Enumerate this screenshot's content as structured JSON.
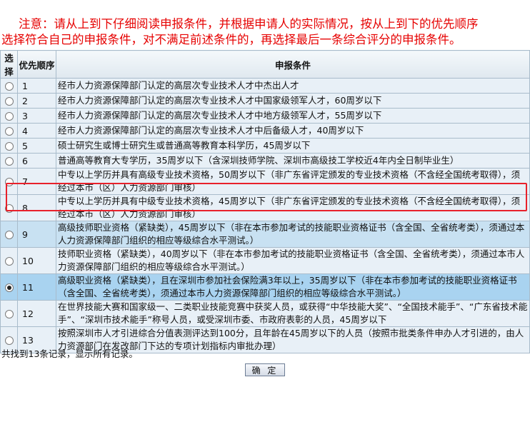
{
  "notice": {
    "line1": "注意：请从上到下仔细阅读申报条件，并根据申请人的实际情况，按从上到下的优先顺序",
    "line2": "选择符合自己的申报条件，对不满足前述条件的，再选择最后一条综合评分的申报条件。"
  },
  "table": {
    "headers": [
      "选择",
      "优先顺序",
      "申报条件"
    ],
    "rows": [
      {
        "num": "1",
        "text": "经市人力资源保障部门认定的高层次专业技术人才中杰出人才"
      },
      {
        "num": "2",
        "text": "经市人力资源保障部门认定的高层次专业技术人才中国家级领军人才，60周岁以下"
      },
      {
        "num": "3",
        "text": "经市人力资源保障部门认定的高层次专业技术人才中地方级领军人才，55周岁以下"
      },
      {
        "num": "4",
        "text": "经市人力资源保障部门认定的高层次专业技术人才中后备级人才，40周岁以下"
      },
      {
        "num": "5",
        "text": "硕士研究生或博士研究生或普通高等教育本科学历，45周岁以下"
      },
      {
        "num": "6",
        "text": "普通高等教育大专学历，35周岁以下（含深圳技师学院、深圳市高级技工学校近4年内全日制毕业生）"
      },
      {
        "num": "7",
        "text": "中专以上学历并具有高级专业技术资格，50周岁以下（非广东省评定颁发的专业技术资格（不含经全国统考取得），须经过本市（区）人力资源部门审核）"
      },
      {
        "num": "8",
        "text": "中专以上学历并具有中级专业技术资格，45周岁以下（非广东省评定颁发的专业技术资格（不含经全国统考取得），须经过本市（区）人力资源部门审核）"
      },
      {
        "num": "9",
        "text": "高级技师职业资格（紧缺类），45周岁以下（非在本市参加考试的技能职业资格证书（含全国、全省统考类），须通过本人力资源保障部门组织的相应等级综合水平测试。）"
      },
      {
        "num": "10",
        "text": "技师职业资格（紧缺类），40周岁以下（非在本市参加考试的技能职业资格证书（含全国、全省统考类），须通过本市人力资源保障部门组织的相应等级综合水平测试。）"
      },
      {
        "num": "11",
        "text": "高级职业资格（紧缺类），且在深圳市参加社会保险满3年以上，35周岁以下（非在本市参加考试的技能职业资格证书（含全国、全省统考类），须通过本市人力资源保障部门组织的相应等级综合水平测试。）"
      },
      {
        "num": "12",
        "text": "在世界技能大赛和国家级一、二类职业技能竞赛中获奖人员，或获得“中华技能大奖”、“全国技术能手”、“广东省技术能手”、“深圳市技术能手”称号人员，或受深圳市委、市政府表彰的人员，45周岁以下"
      },
      {
        "num": "13",
        "text": "按照深圳市人才引进综合分值表测评达到100分，且年龄在45周岁以下的人员（按照市批类条件申办人才引进的，由人力资源部门在发改部门下达的专项计划指标内审批办理）"
      }
    ]
  },
  "footer": {
    "records": "共找到13条记录，显示所有记录。"
  },
  "button": {
    "ok": "确 定"
  },
  "selected_row": "11"
}
